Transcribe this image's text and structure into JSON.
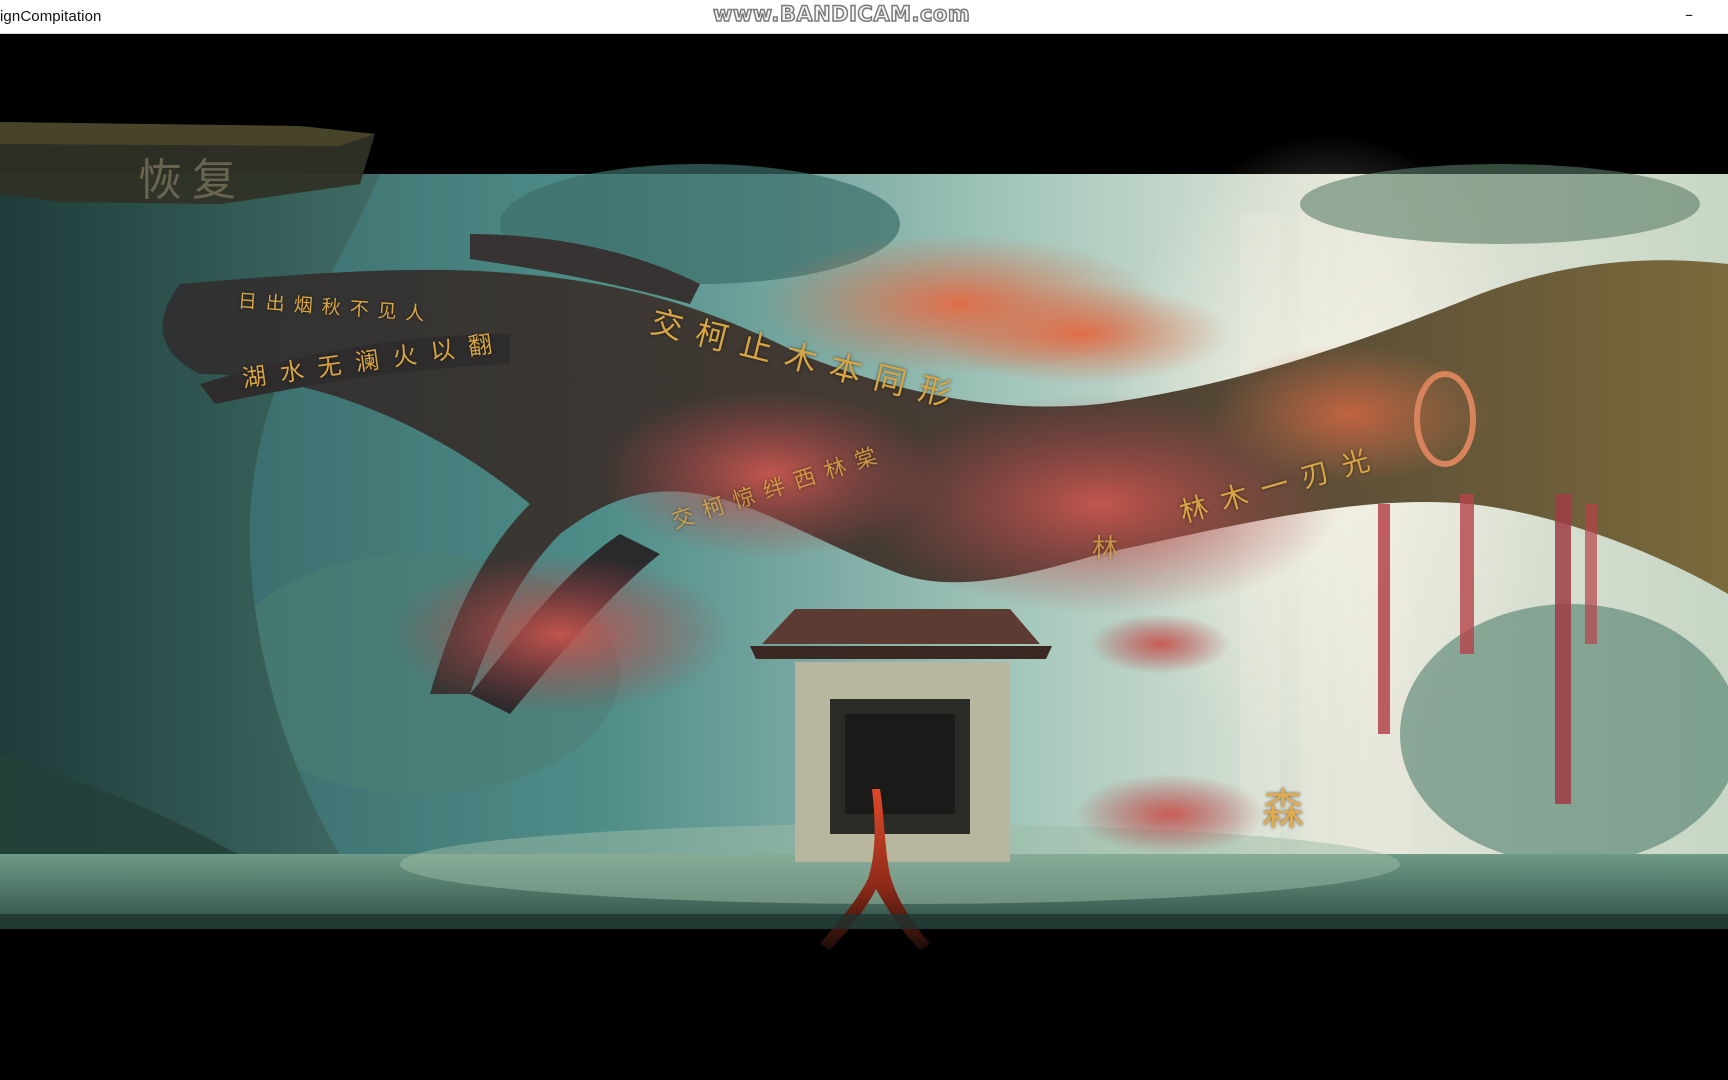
{
  "window": {
    "title": "ignCompitation",
    "minimize_glyph": "–"
  },
  "watermark": "www.BANDICAM.com",
  "banner": {
    "label": "恢复"
  },
  "branch_inscriptions": [
    {
      "text": "日出烟秋不见人"
    },
    {
      "text": "湖水无澜火以翻"
    },
    {
      "text": "交柯止木本同形"
    },
    {
      "text": "交柯惊绊西林棠"
    },
    {
      "text": "林木一刃光"
    },
    {
      "text": "林"
    }
  ],
  "ground_glyph": "森",
  "character_glyph": "人",
  "colors": {
    "sky_top": "#cfe0d2",
    "mist": "#e7ecdd",
    "teal": "#4d8a86",
    "dark_teal": "#2b4b4e",
    "trunk": "#3b3836",
    "foliage_red": "#b24a4a",
    "foliage_orange": "#d97f5a",
    "inscription_gold": "#d8a544",
    "character_red": "#c0351b"
  }
}
